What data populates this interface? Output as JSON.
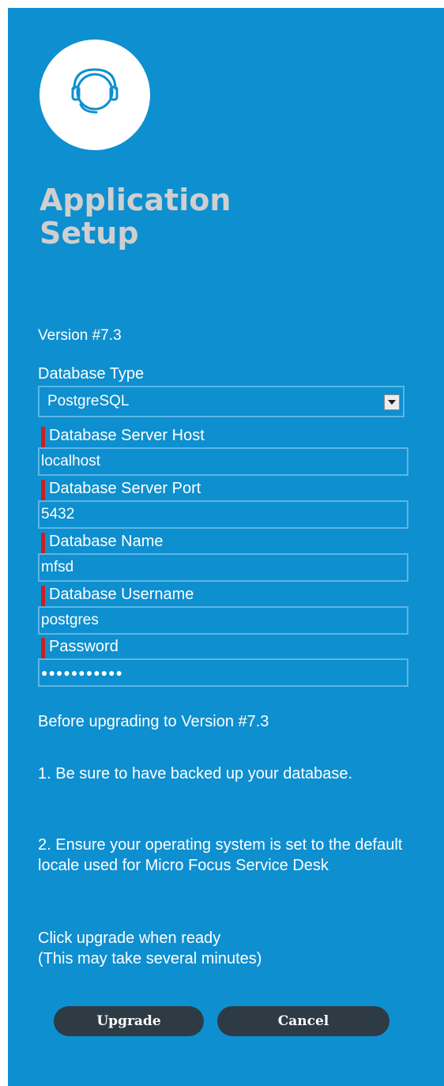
{
  "app": {
    "title_line1": "Application",
    "title_line2": "Setup",
    "logo_icon": "headset-icon"
  },
  "version": "Version #7.3",
  "form": {
    "database_type": {
      "label": "Database Type",
      "selected": "PostgreSQL"
    },
    "server_host": {
      "label": "Database Server Host",
      "value": "localhost",
      "required": true
    },
    "server_port": {
      "label": "Database Server Port",
      "value": "5432",
      "required": true
    },
    "database_name": {
      "label": "Database Name",
      "value": "mfsd",
      "required": true
    },
    "username": {
      "label": "Database Username",
      "value": "postgres",
      "required": true
    },
    "password": {
      "label": "Password",
      "masked_value": "●●●●●●●●●●●",
      "required": true
    }
  },
  "info": {
    "heading": "Before upgrading to Version #7.3",
    "step1": "1. Be sure to have backed up your database.",
    "step2": "2. Ensure your operating system is set to the default locale used for Micro Focus Service Desk",
    "ready_line1": "Click upgrade when ready",
    "ready_line2": "(This may take several minutes)"
  },
  "buttons": {
    "upgrade": "Upgrade",
    "cancel": "Cancel"
  },
  "colors": {
    "panel_bg": "#0e8fcf",
    "title": "#cfcfcf",
    "required_mark": "#cc1f1f",
    "input_border": "#5ab6e6",
    "button_bg": "#2e3b45"
  }
}
